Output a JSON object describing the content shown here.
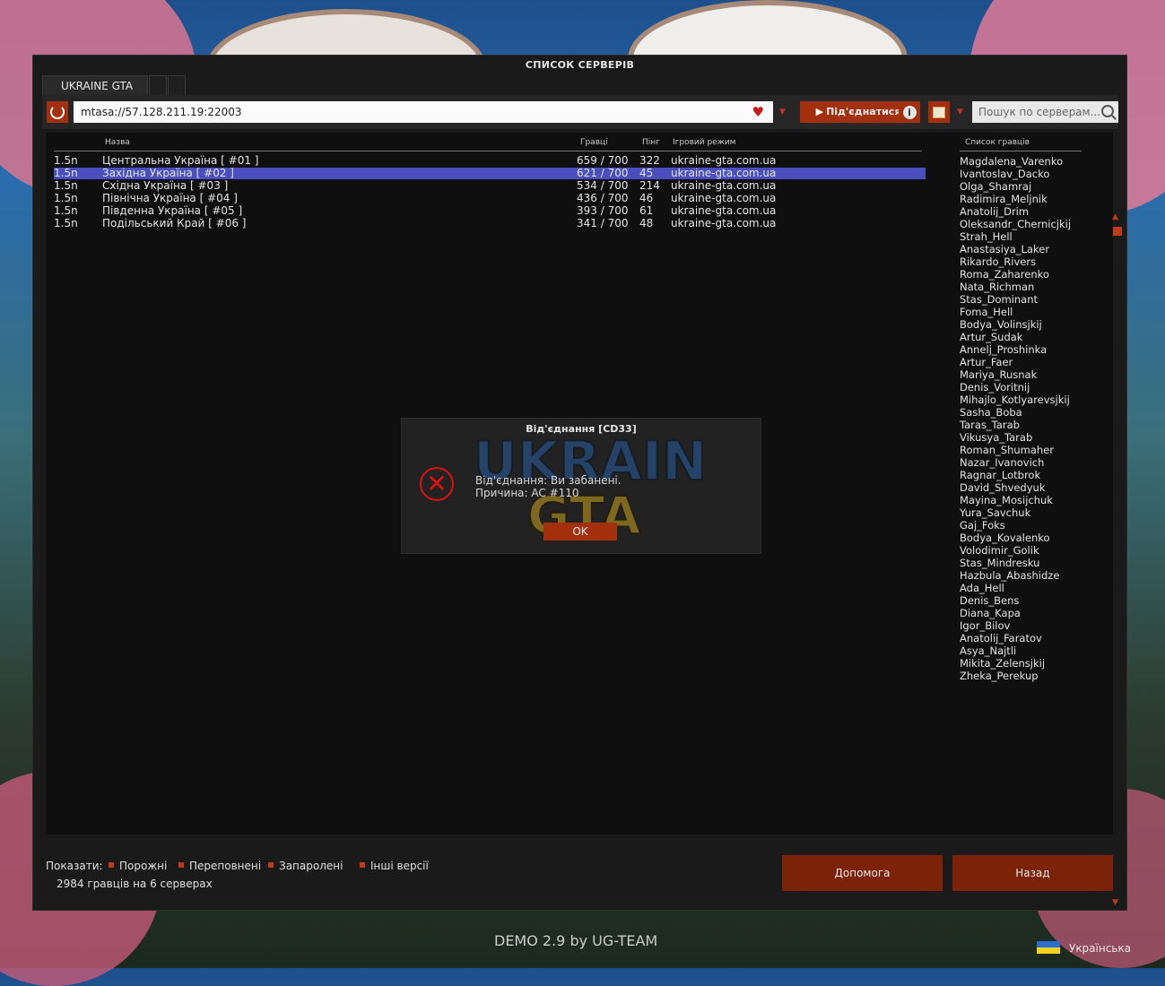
{
  "window": {
    "title": "СПИСОК СЕРВЕРІВ"
  },
  "tabs": [
    {
      "label": "UKRAINE GTA"
    }
  ],
  "toolbar": {
    "address": "mtasa://57.128.211.19:22003",
    "connect_label": "Під'єднатися",
    "search_placeholder": "Пошук по серверам..."
  },
  "table": {
    "headers": {
      "name": "Назва",
      "players": "Гравці",
      "ping": "Пінг",
      "mode": "Ігровий режим"
    },
    "rows": [
      {
        "version": "1.5n",
        "name": "Центральна Україна [ #01 ]",
        "players": "659 / 700",
        "ping": "322",
        "mode": "ukraine-gta.com.ua"
      },
      {
        "version": "1.5n",
        "name": "Західна Україна [ #02 ]",
        "players": "621 / 700",
        "ping": "45",
        "mode": "ukraine-gta.com.ua"
      },
      {
        "version": "1.5n",
        "name": "Східна Україна [ #03 ]",
        "players": "534 / 700",
        "ping": "214",
        "mode": "ukraine-gta.com.ua"
      },
      {
        "version": "1.5n",
        "name": "Північна Україна [ #04 ]",
        "players": "436 / 700",
        "ping": "46",
        "mode": "ukraine-gta.com.ua"
      },
      {
        "version": "1.5n",
        "name": "Південна Україна [ #05 ]",
        "players": "393 / 700",
        "ping": "61",
        "mode": "ukraine-gta.com.ua"
      },
      {
        "version": "1.5n",
        "name": "Подільський Край [ #06 ]",
        "players": "341 / 700",
        "ping": "48",
        "mode": "ukraine-gta.com.ua"
      }
    ]
  },
  "player_list": {
    "header": "Список гравців",
    "players": [
      "Magdalena_Varenko",
      "Ivantoslav_Dacko",
      "Olga_Shamraj",
      "Radimira_Meljnik",
      "Anatolij_Drim",
      "Oleksandr_Chernicjkij",
      "Strah_Hell",
      "Anastasiya_Laker",
      "Rikardo_Rivers",
      "Roma_Zaharenko",
      "Nata_Richman",
      "Stas_Dominant",
      "Foma_Hell",
      "Bodya_Volinsjkij",
      "Artur_Sudak",
      "Annelj_Proshinka",
      "Artur_Faer",
      "Mariya_Rusnak",
      "Denis_Voritnij",
      "Mihajlo_Kotlyarevsjkij",
      "Sasha_Boba",
      "Taras_Tarab",
      "Vikusya_Tarab",
      "Roman_Shumaher",
      "Nazar_Ivanovich",
      "Ragnar_Lotbrok",
      "David_Shvedyuk",
      "Mayina_Mosijchuk",
      "Yura_Savchuk",
      "Gaj_Foks",
      "Bodya_Kovalenko",
      "Volodimir_Golik",
      "Stas_Mindresku",
      "Hazbula_Abashidze",
      "Ada_Hell",
      "Denis_Bens",
      "Diana_Kapa",
      "Igor_Bilov",
      "Anatolij_Faratov",
      "Asya_Najtli",
      "Mikita_Zelensjkij",
      "Zheka_Perekup"
    ]
  },
  "dialog": {
    "title": "Від'єднання [CD33]",
    "message": "Від'єднання: Ви забанені.",
    "reason": "Причина: AC #110",
    "ok_label": "OK"
  },
  "filters": {
    "label": "Показати:",
    "items": [
      "Порожні",
      "Переповнені",
      "Запаролені",
      "Інші версії"
    ]
  },
  "status": {
    "count": "2984 гравців на 6 серверах"
  },
  "buttons": {
    "help": "Допомога",
    "back": "Назад"
  },
  "footer": {
    "version": "DEMO 2.9 by UG-TEAM",
    "language": "Українська"
  },
  "colors": {
    "accent": "#a32f0c",
    "selected_row": "#4a4fbd",
    "background": "#1a1a1a"
  }
}
